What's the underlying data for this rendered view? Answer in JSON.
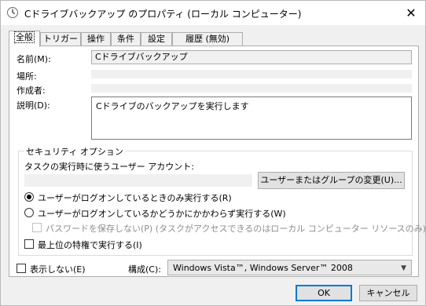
{
  "window": {
    "title": "Cドライブバックアップ のプロパティ (ローカル コンピューター)"
  },
  "tabs": [
    {
      "label": "全般",
      "active": true
    },
    {
      "label": "トリガー",
      "active": false
    },
    {
      "label": "操作",
      "active": false
    },
    {
      "label": "条件",
      "active": false
    },
    {
      "label": "設定",
      "active": false
    },
    {
      "label": "履歴 (無効)",
      "active": false
    }
  ],
  "general": {
    "name_label": "名前(M):",
    "name_value": "Cドライブバックアップ",
    "location_label": "場所:",
    "location_value": "",
    "author_label": "作成者:",
    "author_value": "",
    "description_label": "説明(D):",
    "description_value": "Cドライブのバックアップを実行します"
  },
  "security": {
    "group_title": "セキュリティ オプション",
    "account_label": "タスクの実行時に使うユーザー アカウント:",
    "account_value": "",
    "change_user_button": "ユーザーまたはグループの変更(U)...",
    "radio_logged_on": "ユーザーがログオンしているときのみ実行する(R)",
    "radio_whether": "ユーザーがログオンしているかどうかにかかわらず実行する(W)",
    "radio_selected": "logged_on",
    "no_store_password": "パスワードを保存しない(P) (タスクがアクセスできるのはローカル コンピューター リソースのみ)",
    "highest_privileges": "最上位の特権で実行する(I)"
  },
  "footer": {
    "hidden_label": "表示しない(E)",
    "configure_label": "構成(C):",
    "configure_value": "Windows Vista™, Windows Server™ 2008",
    "ok_button": "OK",
    "cancel_button": "キャンセル"
  }
}
